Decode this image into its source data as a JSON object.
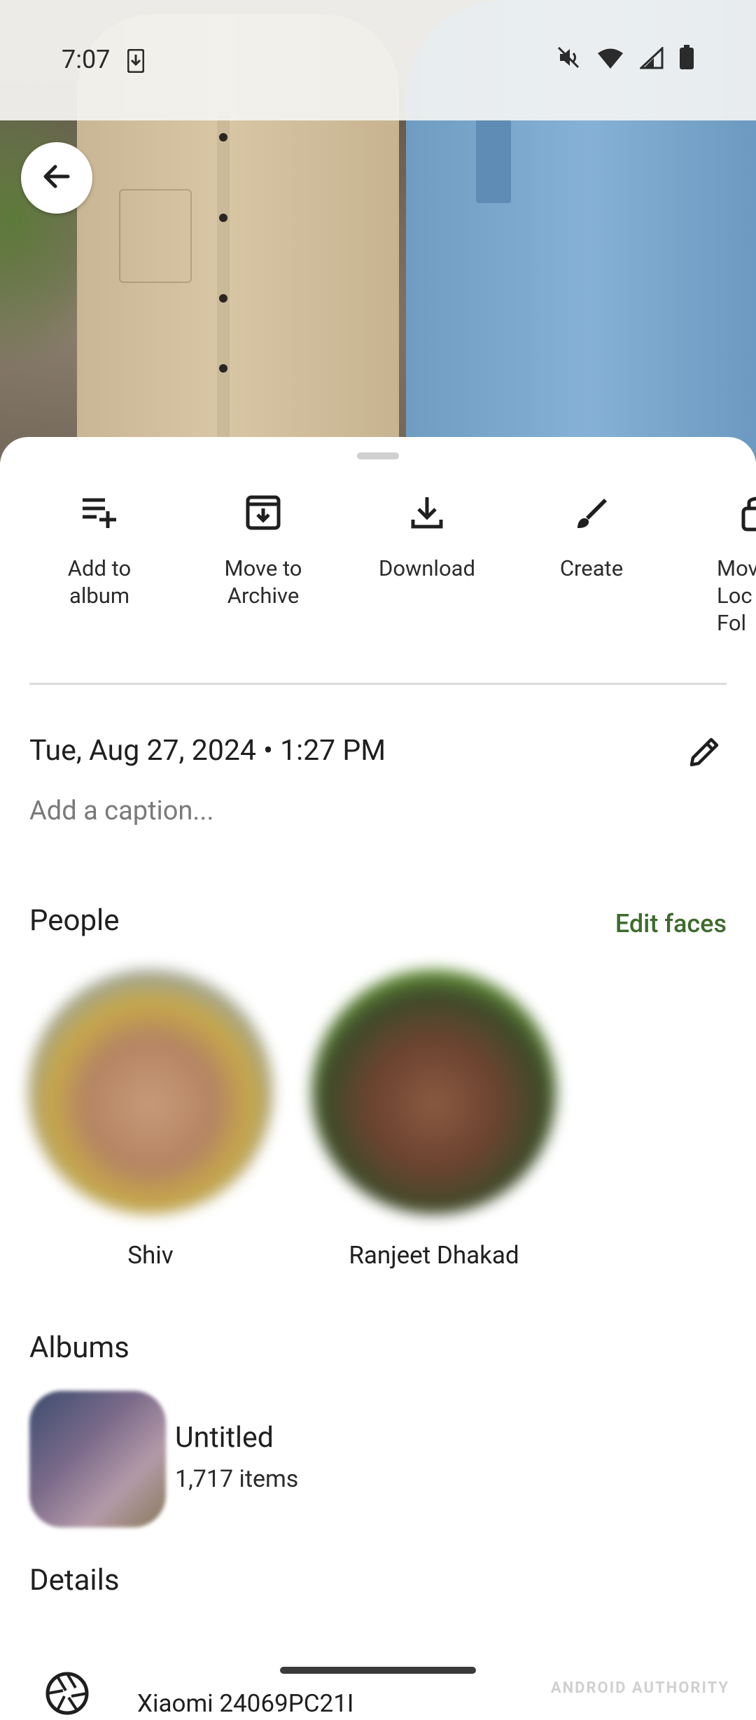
{
  "status_bar": {
    "time": "7:07",
    "icons": [
      "download-notification-icon",
      "mute-icon",
      "wifi-icon",
      "signal-icon",
      "battery-icon"
    ]
  },
  "actions": [
    {
      "label": "Add to album",
      "line1": "Add to",
      "line2": "album",
      "icon": "playlist-add-icon"
    },
    {
      "label": "Move to Archive",
      "line1": "Move to",
      "line2": "Archive",
      "icon": "archive-icon"
    },
    {
      "label": "Download",
      "line1": "Download",
      "line2": "",
      "icon": "download-icon"
    },
    {
      "label": "Create",
      "line1": "Create",
      "line2": "",
      "icon": "brush-icon"
    },
    {
      "label": "Move to Locked Folder",
      "line1": "Mov",
      "line2": "Loc",
      "line3": "Fol",
      "icon": "lock-icon"
    }
  ],
  "info": {
    "datetime": "Tue, Aug 27, 2024  •  1:27 PM",
    "caption_placeholder": "Add a caption..."
  },
  "people": {
    "title": "People",
    "edit_label": "Edit faces",
    "faces": [
      {
        "name": "Shiv"
      },
      {
        "name": "Ranjeet Dhakad"
      }
    ]
  },
  "albums": {
    "title": "Albums",
    "items": [
      {
        "title": "Untitled",
        "count": "1,717 items"
      }
    ]
  },
  "details": {
    "title": "Details",
    "device": "Xiaomi 24069PC21I"
  },
  "watermark": "ANDROID AUTHORITY",
  "colors": {
    "accent_green": "#3d6b2d",
    "sheet_bg": "#ffffff",
    "divider": "#dcdcdc"
  }
}
